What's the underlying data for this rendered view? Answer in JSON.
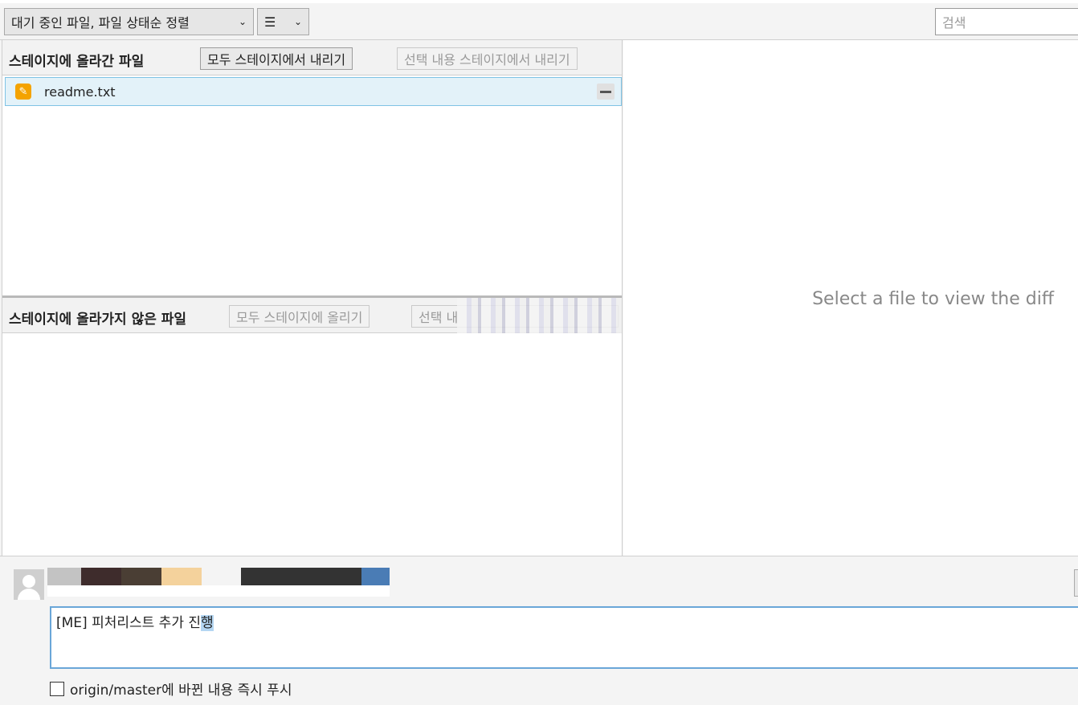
{
  "toolbar": {
    "sort_select_label": "대기 중인 파일, 파일 상태순 정렬",
    "view_select_icon": "☰",
    "search_placeholder": "검색"
  },
  "staged": {
    "title": "스테이지에 올라간 파일",
    "unstage_all_label": "모두 스테이지에서 내리기",
    "unstage_selected_label": "선택 내용 스테이지에서 내리기",
    "files": [
      {
        "name": "readme.txt",
        "status_icon": "pencil-icon"
      }
    ]
  },
  "unstaged": {
    "title": "스테이지에 올라가지 않은 파일",
    "stage_all_label": "모두 스테이지에 올리기",
    "stage_selected_label": "선택 내",
    "files": []
  },
  "diff": {
    "hint": "Select a file to view the diff"
  },
  "commit": {
    "message_prefix": "[ME] 피처리스트 추가 진",
    "message_selected": "행",
    "push_label": "origin/master에 바뀐 내용 즉시 푸시",
    "push_checked": false
  }
}
